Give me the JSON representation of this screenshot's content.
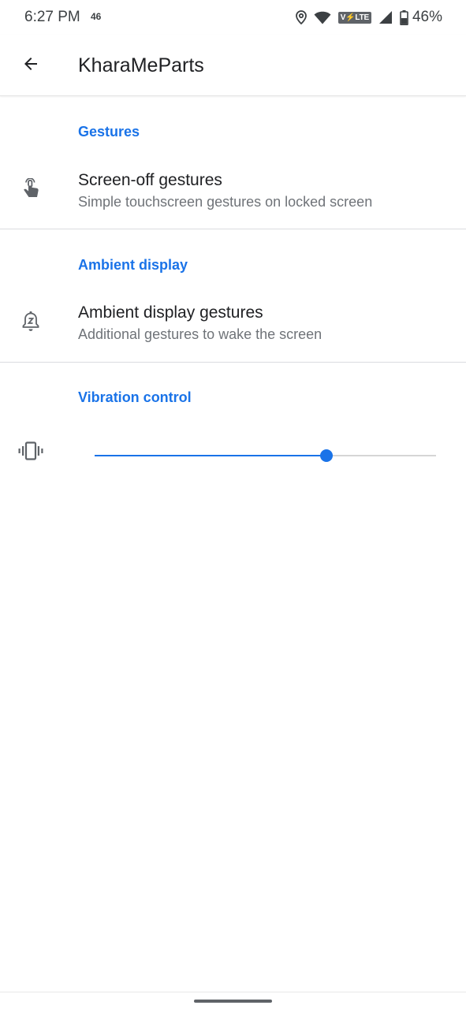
{
  "status_bar": {
    "time": "6:27 PM",
    "network": "46",
    "volte": "V⚡LTE",
    "battery": "46%",
    "icons": [
      "location-icon",
      "wifi-icon",
      "volte-icon",
      "signal-icon",
      "battery-icon"
    ]
  },
  "toolbar": {
    "back_icon": "arrow-back-icon",
    "title": "KharaMeParts"
  },
  "sections": [
    {
      "category": "Gestures",
      "item": {
        "icon": "touch-gesture-icon",
        "title": "Screen-off gestures",
        "summary": "Simple touchscreen gestures on locked screen"
      }
    },
    {
      "category": "Ambient display",
      "item": {
        "icon": "notification-sleep-icon",
        "title": "Ambient display gestures",
        "summary": "Additional gestures to wake the screen"
      }
    },
    {
      "category": "Vibration control",
      "item": {
        "icon": "vibration-icon",
        "slider_value": 0.68
      }
    }
  ],
  "colors": {
    "accent": "#1a73e8",
    "text_primary": "#202124",
    "text_secondary": "#6f7378"
  }
}
